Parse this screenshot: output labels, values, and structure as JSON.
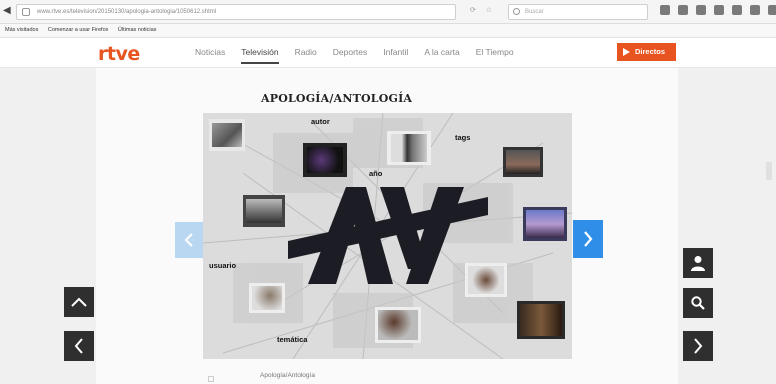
{
  "browser": {
    "url": "www.rtve.es/television/20150130/apologia-antologia/1050612.shtml",
    "search_placeholder": "Buscar",
    "bookmarks": [
      "Más visitados",
      "Comenzar a usar Firefox",
      "Últimas noticias"
    ]
  },
  "site": {
    "logo": "rtve",
    "brand_color": "#e8541f",
    "nav": [
      {
        "label": "Noticias",
        "active": false
      },
      {
        "label": "Televisión",
        "active": true
      },
      {
        "label": "Radio",
        "active": false
      },
      {
        "label": "Deportes",
        "active": false
      },
      {
        "label": "Infantil",
        "active": false
      },
      {
        "label": "A la carta",
        "active": false
      },
      {
        "label": "El Tiempo",
        "active": false
      }
    ],
    "directo_label": "Directos"
  },
  "main": {
    "title": "APOLOGÍA/ANTOLOGÍA",
    "collage_words": {
      "autor": "autor",
      "tags": "tags",
      "anio": "año",
      "usuario": "usuario",
      "tematica": "temática"
    },
    "caption": "Apología/Antología"
  },
  "colors": {
    "accent_blue": "#2f8fe8",
    "dark_button": "#2f2f2f"
  }
}
